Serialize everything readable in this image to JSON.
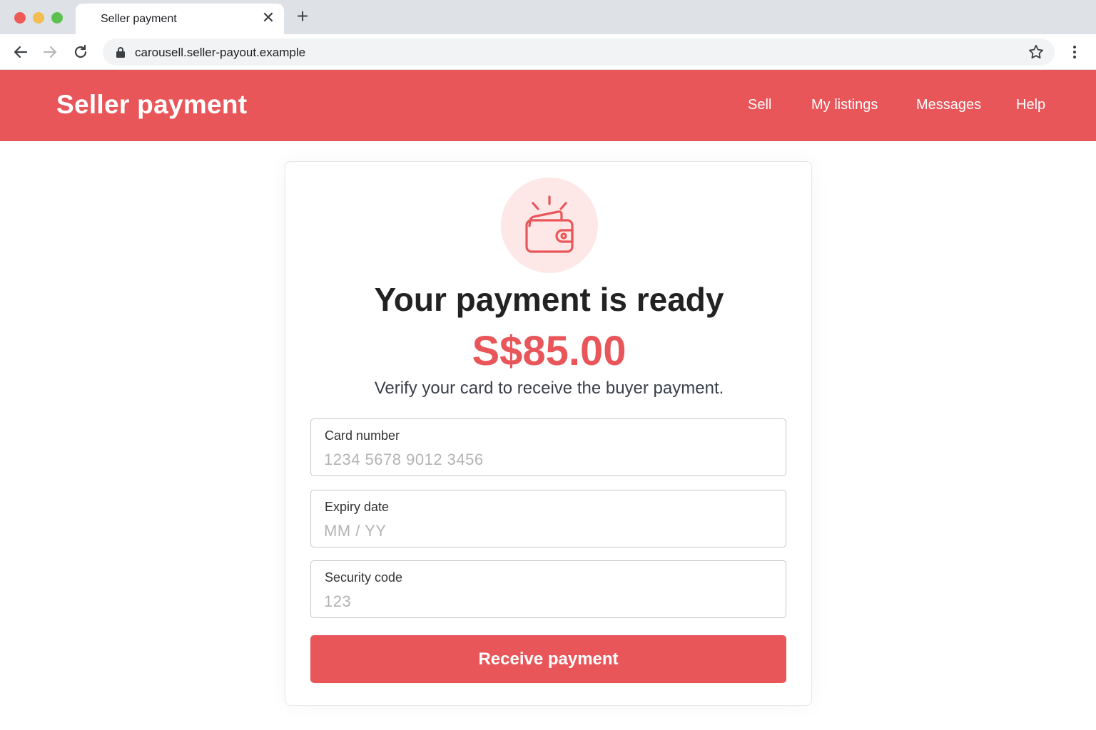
{
  "browser": {
    "tab_title": "Seller payment",
    "tab_close_glyph": "✕",
    "new_tab_glyph": "+",
    "url": "carousell.seller-payout.example",
    "icons": [
      "back-arrow-icon",
      "forward-arrow-icon",
      "reload-icon",
      "lock-icon",
      "bookmark-star-icon",
      "more-menu-icon"
    ]
  },
  "header": {
    "title": "Seller payment",
    "nav": [
      {
        "label": "Sell"
      },
      {
        "label": "My listings"
      },
      {
        "label": "Messages"
      },
      {
        "label": "Help"
      }
    ],
    "background_color": "#e8565a"
  },
  "main": {
    "icon": "wallet-icon",
    "heading": "Your payment is ready",
    "amount": "S$85.00",
    "subtitle": "Verify your card to receive the buyer payment.",
    "fields": [
      {
        "label": "Card number",
        "placeholder": "1234 5678 9012 3456",
        "value": ""
      },
      {
        "label": "Expiry date",
        "placeholder": "MM / YY",
        "value": ""
      },
      {
        "label": "Security code",
        "placeholder": "123",
        "value": ""
      }
    ],
    "submit_label": "Receive payment",
    "accent_color": "#e8565a"
  }
}
